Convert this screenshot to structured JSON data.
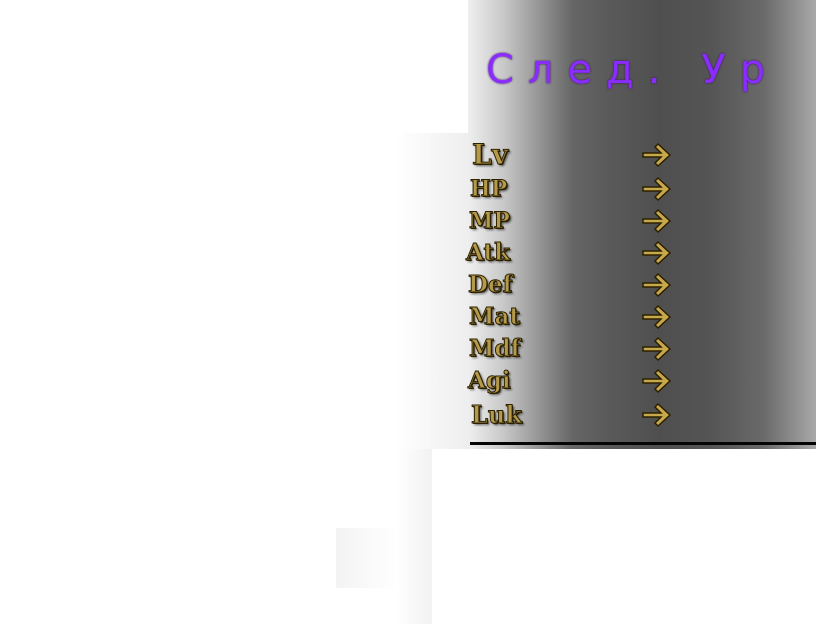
{
  "panel": {
    "title": "След. Ур"
  },
  "stats": [
    {
      "label": "Lv",
      "arrow_icon": "arrow-right-icon"
    },
    {
      "label": "HP",
      "arrow_icon": "arrow-right-icon"
    },
    {
      "label": "MP",
      "arrow_icon": "arrow-right-icon"
    },
    {
      "label": "Atk",
      "arrow_icon": "arrow-right-icon"
    },
    {
      "label": "Def",
      "arrow_icon": "arrow-right-icon"
    },
    {
      "label": "Mat",
      "arrow_icon": "arrow-right-icon"
    },
    {
      "label": "Mdf",
      "arrow_icon": "arrow-right-icon"
    },
    {
      "label": "Agi",
      "arrow_icon": "arrow-right-icon"
    },
    {
      "label": "Luk",
      "arrow_icon": "arrow-right-icon"
    }
  ],
  "colors": {
    "title": "#8a2cff",
    "label_fill": "#b59a4a",
    "label_outline": "#2b2000",
    "arrow_fill": "#c7a84d",
    "divider": "#050505"
  }
}
